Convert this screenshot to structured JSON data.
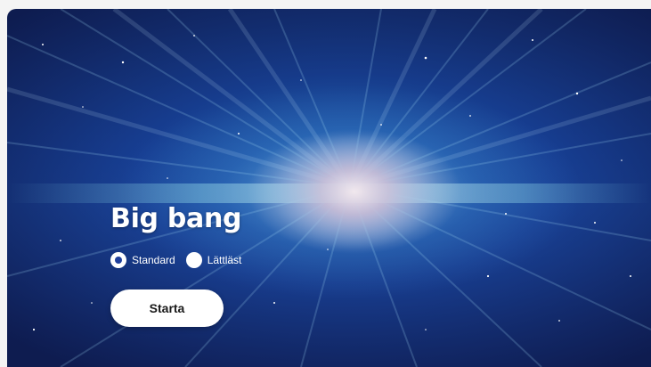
{
  "hero": {
    "title": "Big bang",
    "background_image": "big-bang-space-explosion"
  },
  "mode": {
    "options": [
      {
        "label": "Standard",
        "selected": true
      },
      {
        "label": "Lättläst",
        "selected": false
      }
    ]
  },
  "actions": {
    "start_label": "Starta"
  },
  "colors": {
    "accent": "#1f3f9c",
    "button_bg": "#ffffff",
    "text_light": "#ffffff"
  }
}
